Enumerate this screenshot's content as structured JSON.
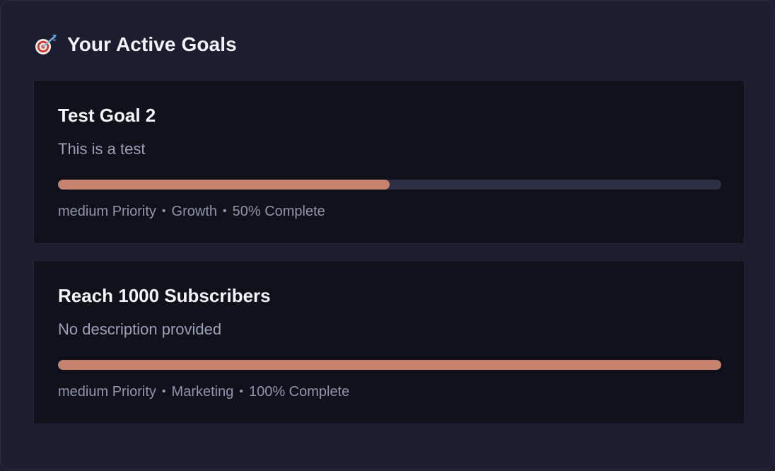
{
  "header": {
    "icon": "target-icon",
    "title": "Your Active Goals"
  },
  "goals": [
    {
      "title": "Test Goal 2",
      "description": "This is a test",
      "progress": 0.5,
      "priority_label": "medium Priority",
      "category": "Growth",
      "completion_label": "50% Complete",
      "separator": "•"
    },
    {
      "title": "Reach 1000 Subscribers",
      "description": "No description provided",
      "progress": 1.0,
      "priority_label": "medium Priority",
      "category": "Marketing",
      "completion_label": "100% Complete",
      "separator": "•"
    }
  ],
  "colors": {
    "background": "#1c1d2f",
    "card": "#10111a",
    "progress_fill": "#c8836e",
    "progress_track": "#2e3046",
    "title": "#f4f5f8",
    "muted_text": "#9aa0b8"
  }
}
